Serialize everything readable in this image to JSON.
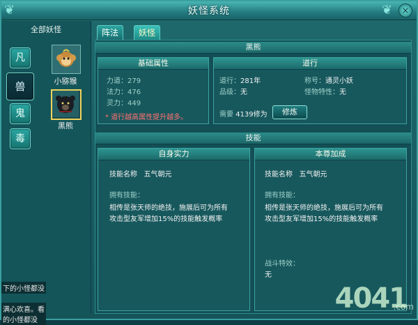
{
  "window": {
    "title": "妖怪系统",
    "close_label": "×"
  },
  "left_panel": {
    "title": "全部妖怪",
    "categories": [
      "凡",
      "兽",
      "鬼",
      "毒"
    ],
    "monsters": [
      {
        "name": "小猕猴"
      },
      {
        "name": "黑熊"
      }
    ],
    "bottom_text": [
      "下的小怪都没",
      "满心欢喜。看",
      "的小怪都没"
    ]
  },
  "tabs": [
    "阵法",
    "妖怪"
  ],
  "monster_header": "黑熊",
  "basic": {
    "title": "基础属性",
    "stats": [
      {
        "label": "力道：",
        "value": "279"
      },
      {
        "label": "法力：",
        "value": "476"
      },
      {
        "label": "灵力：",
        "value": "449"
      }
    ],
    "warning": "* 道行越高属性提升越多。"
  },
  "daoxing": {
    "title": "道行",
    "daoxing_label": "道行：",
    "daoxing_value": "281年",
    "rank_label": "品级：",
    "rank_value": "无",
    "name_label": "称号：",
    "name_value": "通灵小妖",
    "feature_label": "怪物特性：",
    "feature_value": "无",
    "need_label": "需要",
    "need_value": "4139修为",
    "button": "修炼"
  },
  "skills_header": "技能",
  "self_skill": {
    "title": "自身实力",
    "name_label": "技能名称",
    "name_value": "五气朝元",
    "owned_label": "拥有技能：",
    "desc": [
      "相传是张天师的绝技，施展后可为所有",
      "攻击型友军增加15%的技能触发概率"
    ]
  },
  "team_skill": {
    "title": "本尊加成",
    "name_label": "技能名称",
    "name_value": "五气朝元",
    "owned_label": "拥有技能：",
    "desc": [
      "相传是张天师的绝技，施展后可为所有",
      "攻击型友军增加15%的技能触发概率"
    ],
    "battle_label": "战斗特效：",
    "battle_value": "无"
  },
  "watermark": {
    "main": "4041",
    "suffix": ".com"
  }
}
